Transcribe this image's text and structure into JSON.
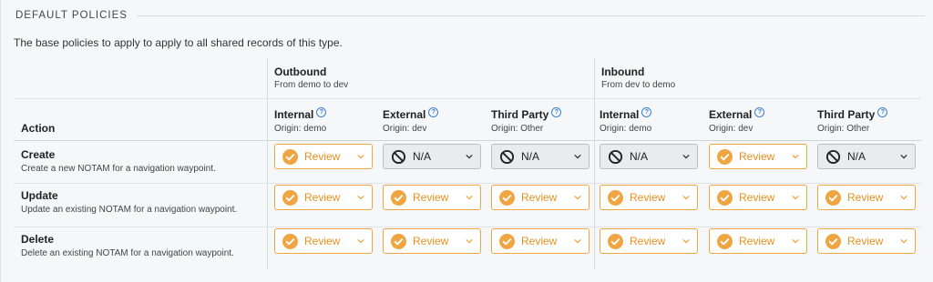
{
  "section": {
    "title": "DEFAULT POLICIES"
  },
  "description": "The base policies to apply to apply to all shared records of this type.",
  "groups": [
    {
      "title": "Outbound",
      "subtitle": "From demo to dev"
    },
    {
      "title": "Inbound",
      "subtitle": "From dev to demo"
    }
  ],
  "action_header": "Action",
  "columns": [
    {
      "title": "Internal",
      "origin": "Origin: demo"
    },
    {
      "title": "External",
      "origin": "Origin: dev"
    },
    {
      "title": "Third Party",
      "origin": "Origin: Other"
    },
    {
      "title": "Internal",
      "origin": "Origin: demo"
    },
    {
      "title": "External",
      "origin": "Origin: dev"
    },
    {
      "title": "Third Party",
      "origin": "Origin: Other"
    }
  ],
  "rows": [
    {
      "title": "Create",
      "subtitle": "Create a new NOTAM for a navigation waypoint.",
      "values": [
        "Review",
        "N/A",
        "N/A",
        "N/A",
        "Review",
        "N/A"
      ]
    },
    {
      "title": "Update",
      "subtitle": "Update an existing NOTAM for a navigation waypoint.",
      "values": [
        "Review",
        "Review",
        "Review",
        "Review",
        "Review",
        "Review"
      ]
    },
    {
      "title": "Delete",
      "subtitle": "Delete an existing NOTAM for a navigation waypoint.",
      "values": [
        "Review",
        "Review",
        "Review",
        "Review",
        "Review",
        "Review"
      ]
    }
  ],
  "colors": {
    "review": "#f0a543",
    "na": "#e9ebee",
    "help": "#3b7fd1"
  }
}
